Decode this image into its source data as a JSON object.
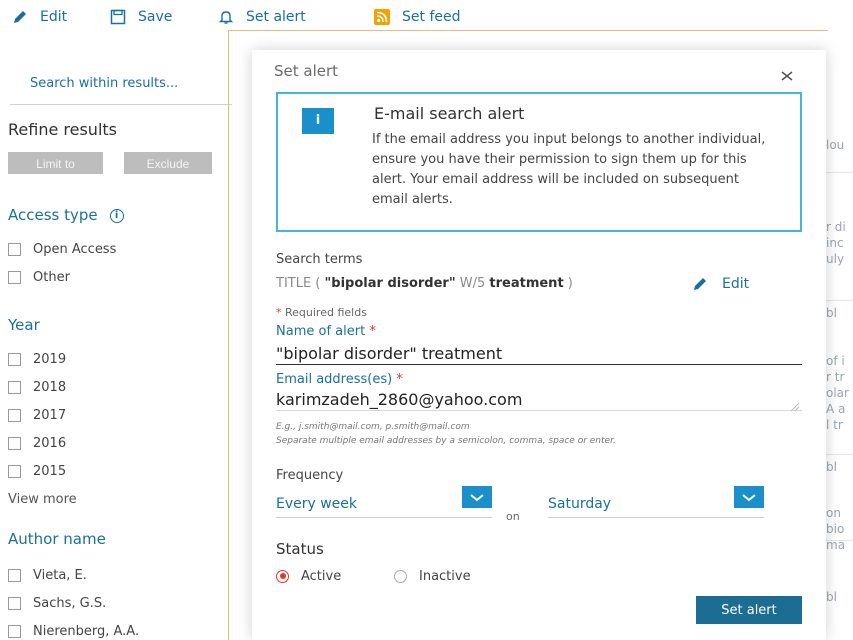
{
  "toolbar": {
    "edit_label": "Edit",
    "save_label": "Save",
    "set_alert_label": "Set alert",
    "set_feed_label": "Set feed"
  },
  "sidebar": {
    "search_placeholder": "Search within results...",
    "refine_title": "Refine results",
    "limit_label": "Limit to",
    "exclude_label": "Exclude",
    "access_type": {
      "title": "Access type",
      "info_glyph": "i",
      "options": [
        "Open Access",
        "Other"
      ]
    },
    "year": {
      "title": "Year",
      "options": [
        "2019",
        "2018",
        "2017",
        "2016",
        "2015"
      ],
      "view_more": "View more"
    },
    "author": {
      "title": "Author name",
      "options": [
        "Vieta, E.",
        "Sachs, G.S.",
        "Nierenberg, A.A."
      ]
    }
  },
  "background_fragments": [
    "lou",
    "r di",
    "inc",
    "uly",
    "bl",
    "of i",
    "r tr",
    "olar",
    "A a",
    "l tr",
    "bl",
    "on",
    "bio",
    "ma",
    "bl"
  ],
  "alert": {
    "title": "Set alert",
    "info_glyph": "i",
    "box_title": "E-mail search alert",
    "box_text": "If the email address you input belongs to another individual, ensure you have their permission to sign them up for this alert. Your email address will be included on subsequent email alerts.",
    "search_terms_label": "Search terms",
    "search_terms": {
      "prefix": "TITLE ( ",
      "term1": "\"bipolar disorder\"",
      "operator": " W/5 ",
      "term2": "treatment",
      "suffix": " )"
    },
    "edit_label": "Edit",
    "required_star": "*",
    "required_note": "Required fields",
    "name_label": "Name of alert",
    "name_value": "\"bipolar disorder\" treatment",
    "email_label": "Email address(es)",
    "email_value": "karimzadeh_2860@yahoo.com",
    "email_hint_1": "E.g., j.smith@mail.com, p.smith@mail.com",
    "email_hint_2": "Separate multiple email addresses by a semicolon, comma, space or enter.",
    "frequency_label": "Frequency",
    "frequency_value": "Every week",
    "on_label": "on",
    "day_value": "Saturday",
    "status_label": "Status",
    "status_options": [
      "Active",
      "Inactive"
    ],
    "submit_label": "Set alert"
  },
  "colors": {
    "link_blue": "#1a6fa0",
    "info_blue": "#1a8fc9",
    "box_border": "#44b7d8",
    "button_blue": "#1b6d93",
    "required_red": "#e8352a",
    "rss_orange": "#f5a100"
  }
}
